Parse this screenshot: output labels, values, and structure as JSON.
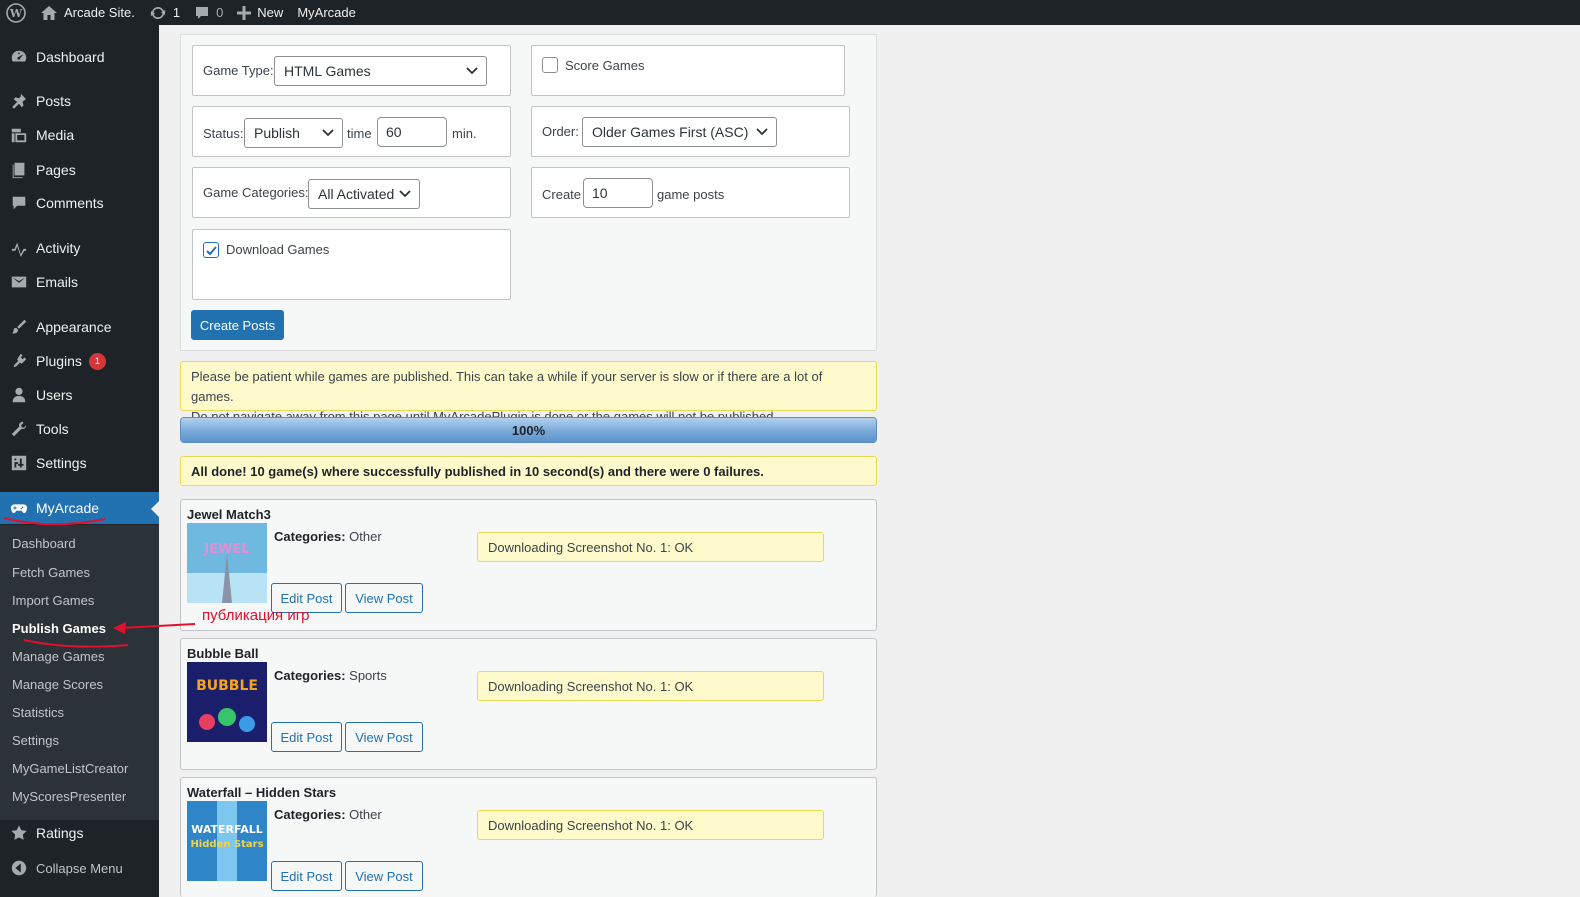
{
  "adminbar": {
    "site_name": "Arcade Site.",
    "updates_count": "1",
    "comments_count": "0",
    "new_label": "New",
    "plugin_link": "MyArcade"
  },
  "sidebar": {
    "items": [
      {
        "label": "Dashboard",
        "icon": "dashboard-icon"
      },
      {
        "label": "Posts",
        "icon": "pin-icon"
      },
      {
        "label": "Media",
        "icon": "media-icon"
      },
      {
        "label": "Pages",
        "icon": "pages-icon"
      },
      {
        "label": "Comments",
        "icon": "comment-icon"
      },
      {
        "label": "Activity",
        "icon": "activity-icon"
      },
      {
        "label": "Emails",
        "icon": "email-icon"
      },
      {
        "label": "Appearance",
        "icon": "brush-icon"
      },
      {
        "label": "Plugins",
        "icon": "plugin-icon",
        "badge": "1"
      },
      {
        "label": "Users",
        "icon": "user-icon"
      },
      {
        "label": "Tools",
        "icon": "wrench-icon"
      },
      {
        "label": "Settings",
        "icon": "settings-icon"
      },
      {
        "label": "MyArcade",
        "icon": "gamepad-icon"
      }
    ],
    "submenu": [
      "Dashboard",
      "Fetch Games",
      "Import Games",
      "Publish Games",
      "Manage Games",
      "Manage Scores",
      "Statistics",
      "Settings",
      "MyGameListCreator",
      "MyScoresPresenter"
    ],
    "ratings": "Ratings",
    "collapse": "Collapse Menu"
  },
  "form": {
    "game_type_label": "Game Type:",
    "game_type_value": "HTML Games",
    "score_games_label": "Score Games",
    "score_games_checked": false,
    "status_label": "Status:",
    "status_value": "Publish",
    "time_label": "time",
    "time_value": "60",
    "min_label": "min.",
    "order_label": "Order:",
    "order_value": "Older Games First (ASC)",
    "categories_label": "Game Categories:",
    "categories_value": "All Activated",
    "create_label": "Create",
    "create_value": "10",
    "game_posts_label": "game posts",
    "download_games_label": "Download Games",
    "download_games_checked": true,
    "create_button": "Create Posts"
  },
  "notice": {
    "line1": "Please be patient while games are published. This can take a while if your server is slow or if there are a lot of games.",
    "line2": "Do not navigate away from this page until MyArcadePlugin is done or the games will not be published."
  },
  "progress": {
    "label": "100%",
    "value": 1.0
  },
  "done_message": "All done! 10 game(s) where successfully published in 10 second(s) and there were 0 failures.",
  "games": [
    {
      "title": "Jewel Match3",
      "categories_label": "Categories:",
      "category": "Other",
      "status": "Downloading Screenshot No. 1: OK",
      "edit": "Edit Post",
      "view": "View Post",
      "thumb_text": "JEWEL MATCH 3",
      "thumb_colors": [
        "#6fb8e0",
        "#b7e3f5",
        "#e98bd6"
      ]
    },
    {
      "title": "Bubble Ball",
      "categories_label": "Categories:",
      "category": "Sports",
      "status": "Downloading Screenshot No. 1: OK",
      "edit": "Edit Post",
      "view": "View Post",
      "thumb_text": "BUBBLE BALL",
      "thumb_colors": [
        "#1b1f6b",
        "#3a2a8a",
        "#f7a41d"
      ]
    },
    {
      "title": "Waterfall – Hidden Stars",
      "categories_label": "Categories:",
      "category": "Other",
      "status": "Downloading Screenshot No. 1: OK",
      "edit": "Edit Post",
      "view": "View Post",
      "thumb_text": "WATERFALL Hidden Stars",
      "thumb_colors": [
        "#2e86c9",
        "#7cc6f0",
        "#f3d34a"
      ]
    }
  ],
  "annotation": {
    "text": "публикация игр",
    "color": "#e0102e"
  }
}
